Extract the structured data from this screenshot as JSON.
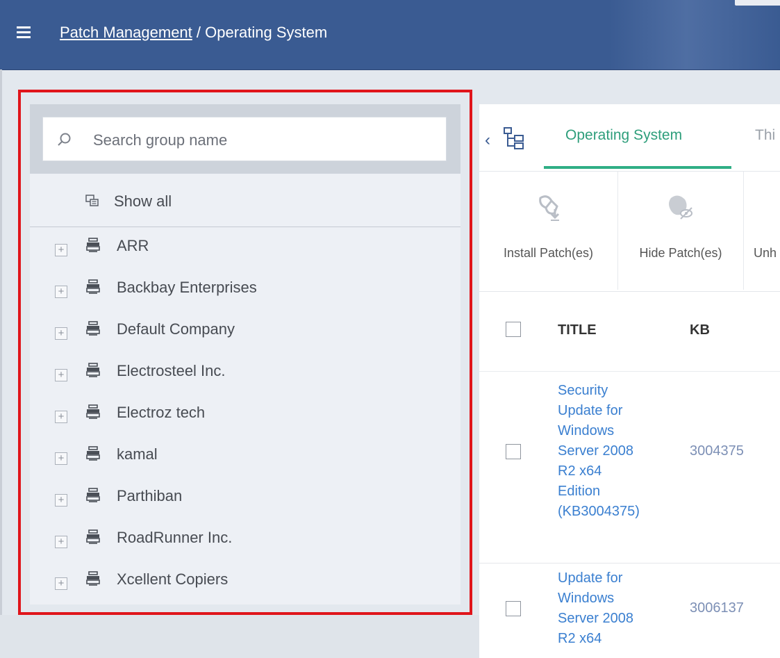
{
  "header": {
    "breadcrumb_link": "Patch Management",
    "breadcrumb_sep": " / ",
    "breadcrumb_current": "Operating System"
  },
  "left_panel": {
    "search_placeholder": "Search group name",
    "show_all_label": "Show all",
    "groups": [
      "ARR",
      "Backbay Enterprises",
      "Default Company",
      "Electrosteel Inc.",
      "Electroz tech",
      "kamal",
      "Parthiban",
      "RoadRunner Inc.",
      "Xcellent Copiers"
    ],
    "highlight_color": "#e0151b"
  },
  "tabs": [
    {
      "label": "Operating System",
      "active": true
    },
    {
      "label": "Thi",
      "active": false
    }
  ],
  "toolbar": {
    "install": "Install Patch(es)",
    "hide": "Hide Patch(es)",
    "unhide": "Unh"
  },
  "table": {
    "headers": {
      "title": "TITLE",
      "kb": "KB"
    },
    "rows": [
      {
        "title_lines": [
          "Security",
          "Update for",
          "Windows",
          "Server 2008",
          "R2 x64",
          "Edition",
          "(KB3004375)"
        ],
        "kb": "3004375"
      },
      {
        "title_lines": [
          "Update for",
          "Windows",
          "Server 2008",
          "R2 x64"
        ],
        "kb": "3006137"
      }
    ]
  },
  "colors": {
    "header_bg": "#3a5b92",
    "tab_active": "#2e9e7b",
    "link": "#3a7fd0"
  },
  "icons": {
    "menu": "hamburger-icon",
    "search": "search-icon",
    "show_all": "show-all-icon",
    "group": "group-icon",
    "expand": "plus-icon",
    "collapse": "chevron-left-icon",
    "tree": "tree-icon",
    "install": "install-patch-icon",
    "hide": "hide-patch-icon"
  }
}
